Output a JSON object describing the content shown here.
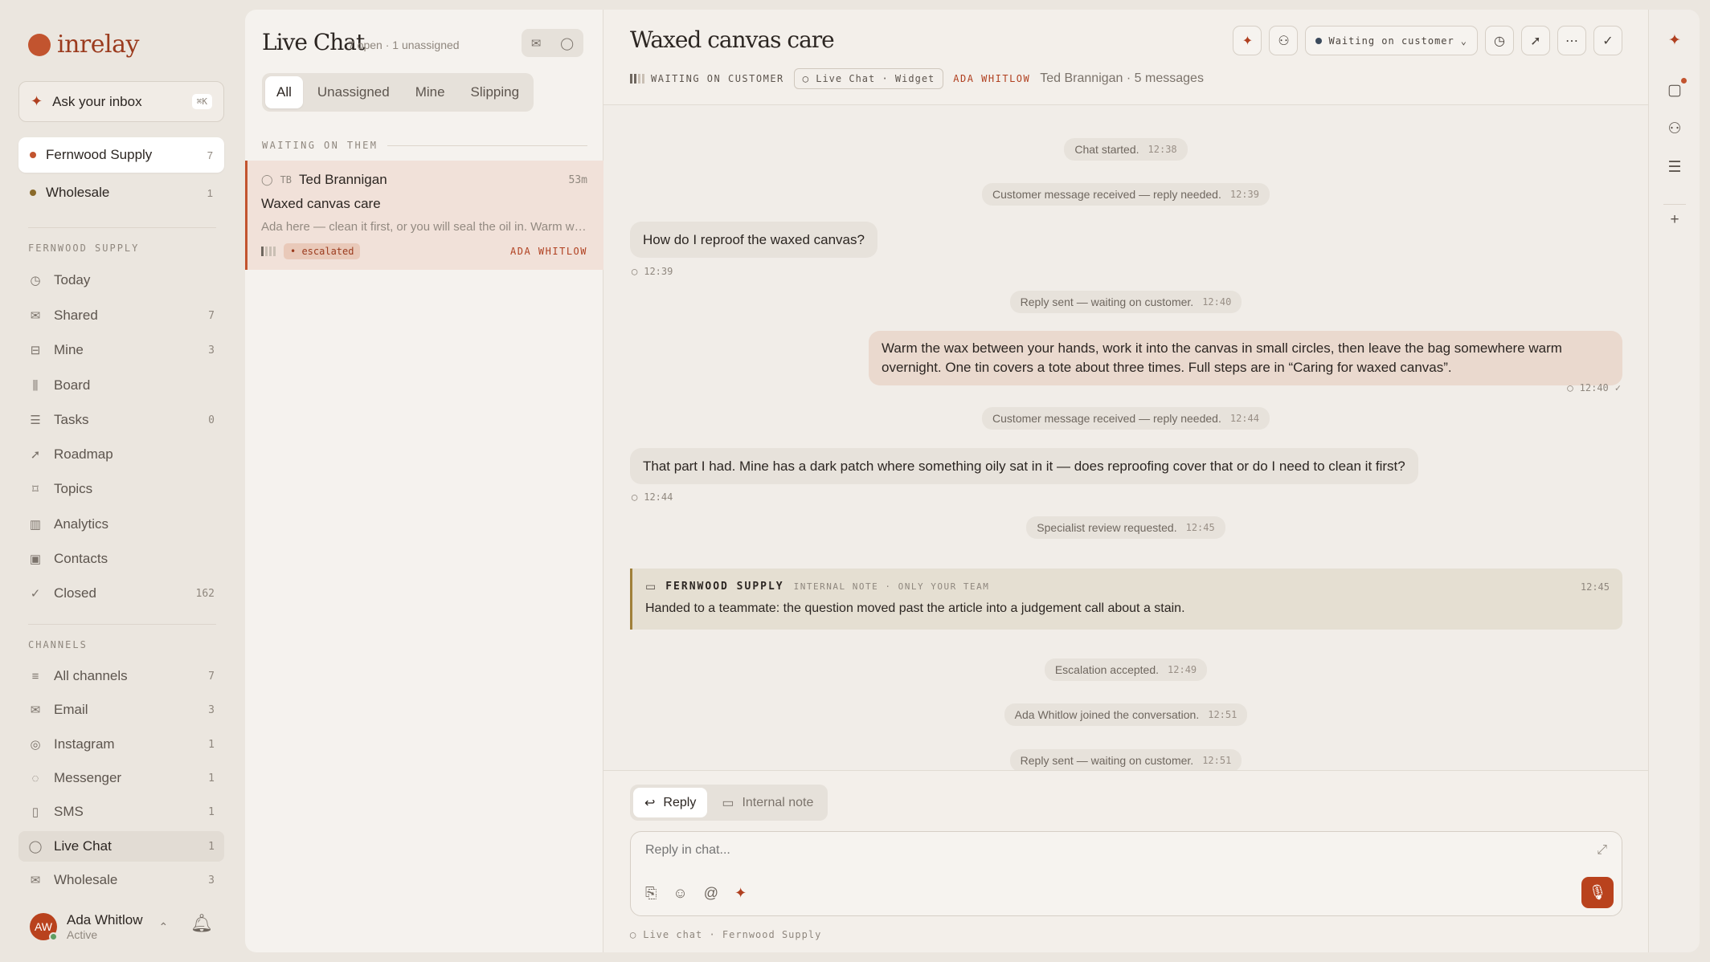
{
  "brand": {
    "name": "inrelay"
  },
  "ask": {
    "label": "Ask your inbox",
    "shortcut": "⌘K"
  },
  "workspaces": [
    {
      "name": "Fernwood Supply",
      "count": "7",
      "color": "#c2542f"
    },
    {
      "name": "Wholesale",
      "count": "1",
      "color": "#8a6a2a"
    }
  ],
  "nav": {
    "section_label": "FERNWOOD SUPPLY",
    "items": [
      {
        "label": "Today",
        "count": "",
        "icon": "clock-icon"
      },
      {
        "label": "Shared",
        "count": "7",
        "icon": "inbox-icon"
      },
      {
        "label": "Mine",
        "count": "3",
        "icon": "tray-icon"
      },
      {
        "label": "Board",
        "count": "",
        "icon": "board-icon"
      },
      {
        "label": "Tasks",
        "count": "0",
        "icon": "tasks-icon"
      },
      {
        "label": "Roadmap",
        "count": "",
        "icon": "rocket-icon"
      },
      {
        "label": "Topics",
        "count": "",
        "icon": "tag-icon"
      },
      {
        "label": "Analytics",
        "count": "",
        "icon": "chart-icon"
      },
      {
        "label": "Contacts",
        "count": "",
        "icon": "contacts-icon"
      },
      {
        "label": "Closed",
        "count": "162",
        "icon": "check-icon"
      }
    ]
  },
  "channels": {
    "section_label": "CHANNELS",
    "items": [
      {
        "label": "All channels",
        "count": "7",
        "icon": "list-icon"
      },
      {
        "label": "Email",
        "count": "3",
        "icon": "mail-icon"
      },
      {
        "label": "Instagram",
        "count": "1",
        "icon": "instagram-icon"
      },
      {
        "label": "Messenger",
        "count": "1",
        "icon": "messenger-icon"
      },
      {
        "label": "SMS",
        "count": "1",
        "icon": "phone-icon"
      },
      {
        "label": "Live Chat",
        "count": "1",
        "icon": "chat-icon"
      },
      {
        "label": "Wholesale",
        "count": "3",
        "icon": "mail-icon"
      }
    ]
  },
  "user": {
    "initials": "AW",
    "name": "Ada Whitlow",
    "status": "Active"
  },
  "list": {
    "title": "Live Chat",
    "subtitle": "7 open · 1 unassigned",
    "tabs": [
      "All",
      "Unassigned",
      "Mine",
      "Slipping"
    ],
    "group_label": "WAITING ON THEM",
    "conversation": {
      "initials": "TB",
      "name": "Ted Brannigan",
      "age": "53m",
      "subject": "Waxed canvas care",
      "preview": "Ada here — clean it first, or you will seal the oil in. Warm water and a soft brush, let it dry fully, then rewax.",
      "tag": "• escalated",
      "assignee": "ADA WHITLOW"
    }
  },
  "conversation": {
    "title": "Waxed canvas care",
    "status": "WAITING ON CUSTOMER",
    "channel": "Live Chat · Widget",
    "assignee": "ADA WHITLOW",
    "people": "Ted Brannigan · 5 messages",
    "status_dropdown": "Waiting on customer",
    "events": {
      "e1": {
        "text": "Chat started.",
        "time": "12:38"
      },
      "e2": {
        "text": "Customer message received — reply needed.",
        "time": "12:39"
      },
      "m1": {
        "text": "How do I reproof the waxed canvas?",
        "time": "12:39"
      },
      "e3": {
        "text": "Reply sent — waiting on customer.",
        "time": "12:40"
      },
      "m2": {
        "text": "Warm the wax between your hands, work it into the canvas in small circles, then leave the bag somewhere warm overnight. One tin covers a tote about three times. Full steps are in “Caring for waxed canvas”.",
        "time": "12:40"
      },
      "e4": {
        "text": "Customer message received — reply needed.",
        "time": "12:44"
      },
      "m3": {
        "text": "That part I had. Mine has a dark patch where something oily sat in it — does reproofing cover that or do I need to clean it first?",
        "time": "12:44"
      },
      "e5": {
        "text": "Specialist review requested.",
        "time": "12:45"
      },
      "note": {
        "team": "FERNWOOD SUPPLY",
        "sub": "INTERNAL NOTE · ONLY YOUR TEAM",
        "time": "12:45",
        "text": "Handed to a teammate: the question moved past the article into a judgement call about a stain."
      },
      "e6": {
        "text": "Escalation accepted.",
        "time": "12:49"
      },
      "e7": {
        "text": "Ada Whitlow joined the conversation.",
        "time": "12:51"
      },
      "e8": {
        "text": "Reply sent — waiting on customer.",
        "time": "12:51"
      }
    }
  },
  "composer": {
    "tabs": {
      "reply": "Reply",
      "note": "Internal note"
    },
    "placeholder": "Reply in chat...",
    "footer": "Live chat · Fernwood Supply"
  },
  "colors": {
    "accent": "#b9421d",
    "background": "#ebe6df"
  }
}
